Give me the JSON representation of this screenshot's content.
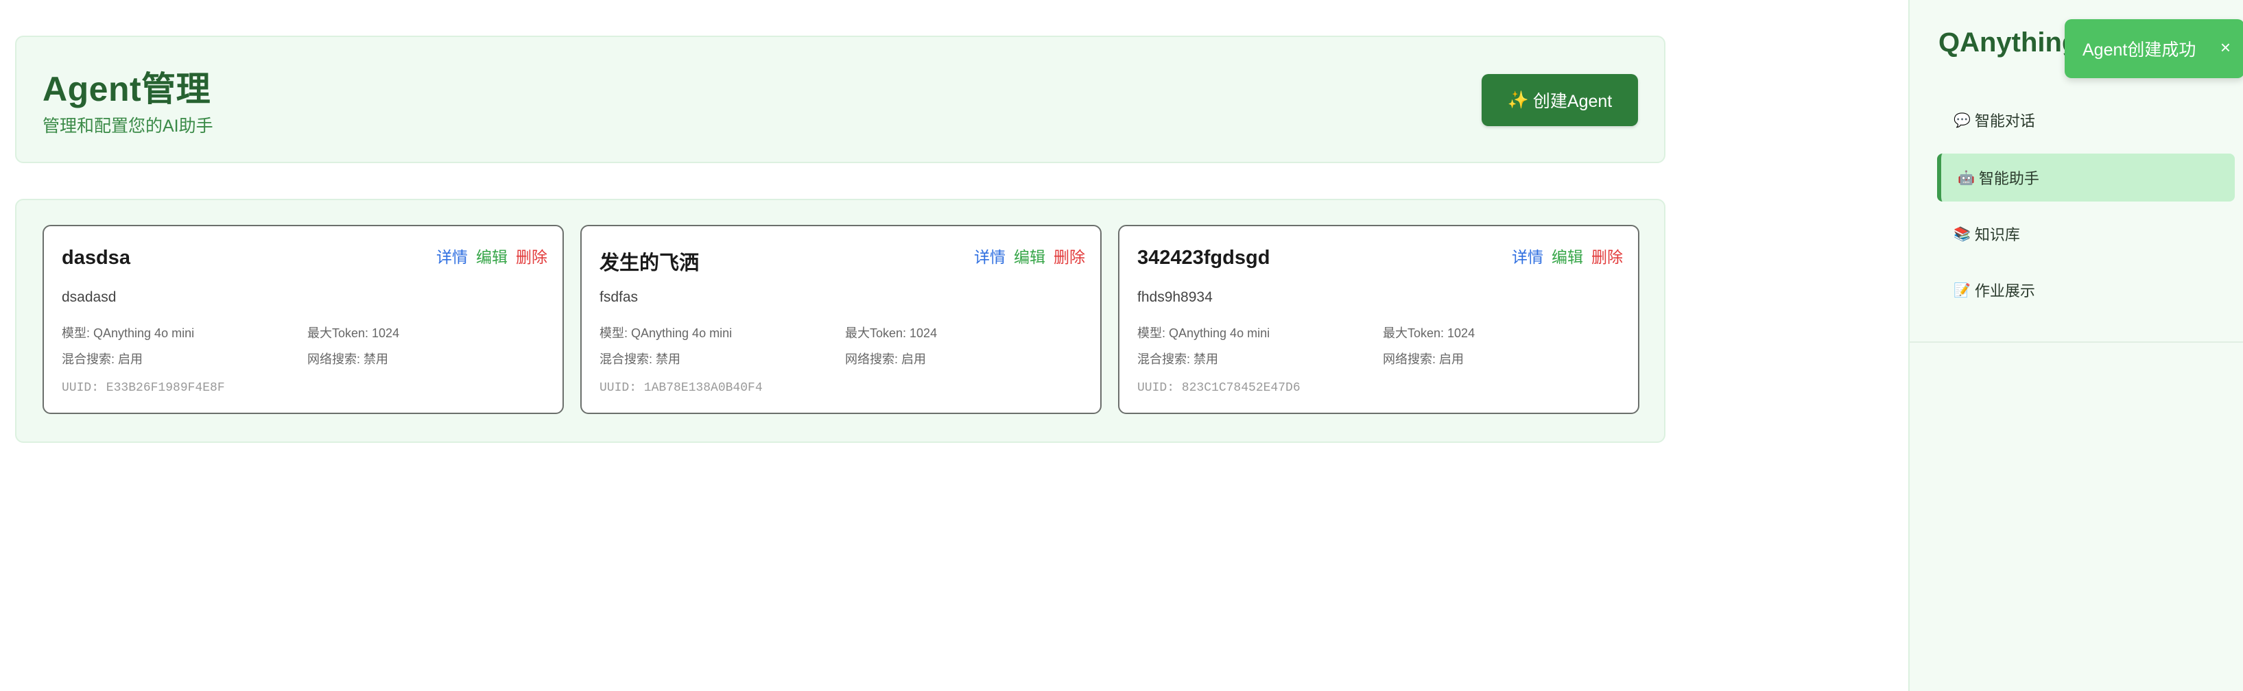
{
  "header": {
    "title": "Agent管理",
    "subtitle": "管理和配置您的AI助手",
    "create_icon": "✨",
    "create_label": "创建Agent"
  },
  "cards": [
    {
      "name": "dasdsa",
      "description": "dsadasd",
      "model": "模型: QAnything 4o mini",
      "max_token": "最大Token: 1024",
      "hybrid_search": "混合搜索: 启用",
      "web_search": "网络搜索: 禁用",
      "uuid": "UUID: E33B26F1989F4E8F",
      "detail_label": "详情",
      "edit_label": "编辑",
      "delete_label": "删除"
    },
    {
      "name": "发生的飞洒",
      "description": "fsdfas",
      "model": "模型: QAnything 4o mini",
      "max_token": "最大Token: 1024",
      "hybrid_search": "混合搜索: 禁用",
      "web_search": "网络搜索: 启用",
      "uuid": "UUID: 1AB78E138A0B40F4",
      "detail_label": "详情",
      "edit_label": "编辑",
      "delete_label": "删除"
    },
    {
      "name": "342423fgdsgd",
      "description": "fhds9h8934",
      "model": "模型: QAnything 4o mini",
      "max_token": "最大Token: 1024",
      "hybrid_search": "混合搜索: 禁用",
      "web_search": "网络搜索: 启用",
      "uuid": "UUID: 823C1C78452E47D6",
      "detail_label": "详情",
      "edit_label": "编辑",
      "delete_label": "删除"
    }
  ],
  "sidebar": {
    "brand": "QAnything",
    "items": [
      {
        "icon": "💬",
        "icon_name": "speech-bubble-icon",
        "label": "智能对话",
        "active": false
      },
      {
        "icon": "🤖",
        "icon_name": "robot-icon",
        "label": "智能助手",
        "active": true
      },
      {
        "icon": "📚",
        "icon_name": "books-icon",
        "label": "知识库",
        "active": false
      },
      {
        "icon": "📝",
        "icon_name": "memo-icon",
        "label": "作业展示",
        "active": false
      }
    ]
  },
  "toast": {
    "message": "Agent创建成功",
    "close": "×"
  },
  "colors": {
    "brand_green": "#276231",
    "button_green": "#2e7d3a",
    "toast_green": "#4ec262",
    "active_nav": "#c6f1cf",
    "detail_blue": "#2f6fe0",
    "edit_green": "#35a547",
    "delete_red": "#e23a3a"
  }
}
